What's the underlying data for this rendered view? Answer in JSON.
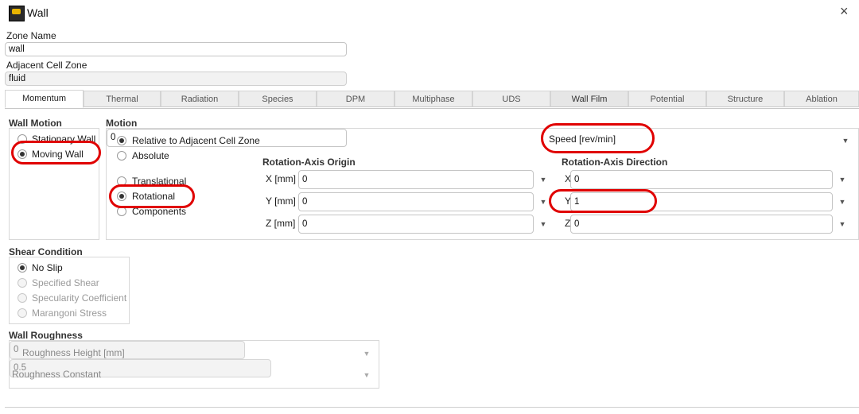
{
  "window": {
    "title": "Wall",
    "close": "×"
  },
  "zone": {
    "name_label": "Zone Name",
    "name_value": "wall",
    "adjacent_label": "Adjacent Cell Zone",
    "adjacent_value": "fluid"
  },
  "tabs": [
    "Momentum",
    "Thermal",
    "Radiation",
    "Species",
    "DPM",
    "Multiphase",
    "UDS",
    "Wall Film",
    "Potential",
    "Structure",
    "Ablation"
  ],
  "active_tab": "Momentum",
  "wall_motion": {
    "title": "Wall Motion",
    "options": [
      "Stationary Wall",
      "Moving Wall"
    ],
    "selected": "Moving Wall"
  },
  "motion": {
    "title": "Motion",
    "frame_options": [
      "Relative to Adjacent Cell Zone",
      "Absolute"
    ],
    "frame_selected": "Relative to Adjacent Cell Zone",
    "type_options": [
      "Translational",
      "Rotational",
      "Components"
    ],
    "type_selected": "Rotational",
    "speed_label": "Speed [rev/min]",
    "speed_value": "0"
  },
  "axis_origin": {
    "title": "Rotation-Axis Origin",
    "x_label": "X [mm]",
    "x_value": "0",
    "y_label": "Y [mm]",
    "y_value": "0",
    "z_label": "Z [mm]",
    "z_value": "0"
  },
  "axis_direction": {
    "title": "Rotation-Axis Direction",
    "x_label": "X",
    "x_value": "0",
    "y_label": "Y",
    "y_value": "1",
    "z_label": "Z",
    "z_value": "0"
  },
  "shear": {
    "title": "Shear Condition",
    "options": [
      "No Slip",
      "Specified Shear",
      "Specularity Coefficient",
      "Marangoni Stress"
    ],
    "selected": "No Slip"
  },
  "roughness": {
    "title": "Wall Roughness",
    "height_label": "Roughness Height [mm]",
    "height_value": "0",
    "constant_label": "Roughness Constant",
    "constant_value": "0.5"
  },
  "icons": {
    "dropdown": "▼",
    "app": "fluent-app-icon"
  },
  "colors": {
    "highlight_circle": "#e00000",
    "tab_bg": "#ededed",
    "active_tab_bg": "#ffffff"
  }
}
